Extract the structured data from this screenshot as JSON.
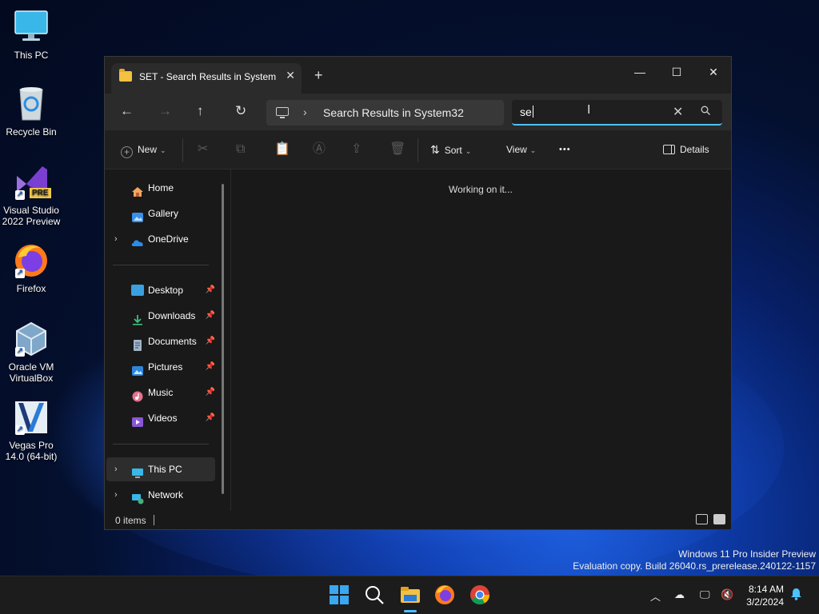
{
  "desktop": {
    "icons": [
      {
        "label": "This PC",
        "icon": "monitor-icon"
      },
      {
        "label": "Recycle Bin",
        "icon": "recycle-bin-icon"
      },
      {
        "label": "Visual Studio 2022 Preview",
        "icon": "visual-studio-icon",
        "badge": "PRE"
      },
      {
        "label": "Firefox",
        "icon": "firefox-icon"
      },
      {
        "label": "Oracle VM VirtualBox",
        "icon": "virtualbox-icon"
      },
      {
        "label": "Vegas Pro 14.0 (64-bit)",
        "icon": "vegas-pro-icon"
      }
    ],
    "watermark": {
      "line1": "Windows 11 Pro Insider Preview",
      "line2": "Evaluation copy. Build 26040.rs_prerelease.240122-1157"
    }
  },
  "explorer": {
    "tab_title": "SET - Search Results in System",
    "tab_close": "✕",
    "new_tab": "+",
    "window_controls": {
      "minimize": "—",
      "maximize": "☐",
      "close": "✕"
    },
    "nav": {
      "back": "←",
      "forward": "→",
      "up": "↑",
      "refresh": "↻"
    },
    "address": {
      "chevron": "›",
      "path": "Search Results in System32"
    },
    "search": {
      "value": "se",
      "clear": "✕",
      "search_icon": "⚲"
    },
    "toolbar": {
      "new_label": "New",
      "sort_label": "Sort",
      "view_label": "View",
      "more_label": "•••",
      "details_label": "Details"
    },
    "sidebar": {
      "top": [
        {
          "label": "Home",
          "icon": "home-icon",
          "expandable": false
        },
        {
          "label": "Gallery",
          "icon": "gallery-icon",
          "expandable": false
        },
        {
          "label": "OneDrive",
          "icon": "onedrive-icon",
          "expandable": true
        }
      ],
      "quick": [
        {
          "label": "Desktop",
          "icon": "desktop-folder-icon"
        },
        {
          "label": "Downloads",
          "icon": "downloads-icon"
        },
        {
          "label": "Documents",
          "icon": "documents-icon"
        },
        {
          "label": "Pictures",
          "icon": "pictures-icon"
        },
        {
          "label": "Music",
          "icon": "music-icon"
        },
        {
          "label": "Videos",
          "icon": "videos-icon"
        }
      ],
      "bottom": [
        {
          "label": "This PC",
          "icon": "this-pc-icon",
          "selected": true
        },
        {
          "label": "Network",
          "icon": "network-icon",
          "selected": false
        }
      ]
    },
    "content_status": "Working on it...",
    "status_bar": {
      "items": "0 items"
    }
  },
  "taskbar": {
    "apps": [
      "start-icon",
      "search-icon",
      "file-explorer-icon",
      "firefox-icon",
      "chrome-icon"
    ],
    "time": "8:14 AM",
    "date": "3/2/2024"
  },
  "colors": {
    "accent": "#4cc2ff",
    "window_bg": "#191919",
    "folder": "#f3c142"
  }
}
